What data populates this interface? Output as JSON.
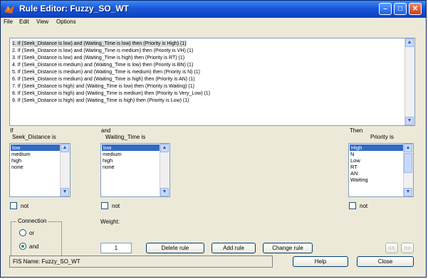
{
  "window": {
    "title": "Rule Editor: Fuzzy_SO_WT"
  },
  "menu": [
    "File",
    "Edit",
    "View",
    "Options"
  ],
  "rules": [
    "1. If (Seek_Distance is low) and (Waiting_Time is low) then (Priority is High) (1)",
    "2. If (Seek_Distance is low) and (Waiting_Time is medium) then (Priority is VH) (1)",
    "3. If (Seek_Distance is low) and (Waiting_Time is high) then (Priority is RT) (1)",
    "4. If (Seek_Distance is medium) and (Waiting_Time is low) then (Priority is BN) (1)",
    "5. If (Seek_Distance is medium) and (Waiting_Time is medium) then (Priority is N) (1)",
    "6. If (Seek_Distance is medium) and (Waiting_Time is high) then (Priority is AN) (1)",
    "7. If (Seek_Distance is high) and (Waiting_Time is low) then (Priority is Waiting) (1)",
    "8. If (Seek_Distance is high) and (Waiting_Time is medium) then (Priority is Very_Low) (1)",
    "9. If (Seek_Distance is high) and (Waiting_Time is high) then (Priority is Low) (1)"
  ],
  "if_section": {
    "if_label": "If",
    "variable": "Seek_Distance is",
    "options": [
      "low",
      "medium",
      "high",
      "none"
    ],
    "selected": "low",
    "not_label": "not"
  },
  "and_section": {
    "and_label": "and",
    "variable": "Waiting_Time is",
    "options": [
      "low",
      "medium",
      "high",
      "none"
    ],
    "selected": "low",
    "not_label": "not"
  },
  "then_section": {
    "then_label": "Then",
    "variable": "Priority is",
    "options": [
      "High",
      "N",
      "Low",
      "RT",
      "AN",
      "Waiting"
    ],
    "selected": "High",
    "not_label": "not"
  },
  "connection": {
    "label": "Connection",
    "options": [
      "or",
      "and"
    ],
    "selected": "and"
  },
  "weight": {
    "label": "Weight:",
    "value": "1"
  },
  "buttons": {
    "delete": "Delete rule",
    "add": "Add rule",
    "change": "Change rule",
    "prev": "<<",
    "next": ">>",
    "help": "Help",
    "close": "Close"
  },
  "status": "FIS Name: Fuzzy_SO_WT",
  "colors": {
    "titlebar": "#1a56d8",
    "selection": "#316ac5",
    "window_bg": "#ece9d8"
  }
}
